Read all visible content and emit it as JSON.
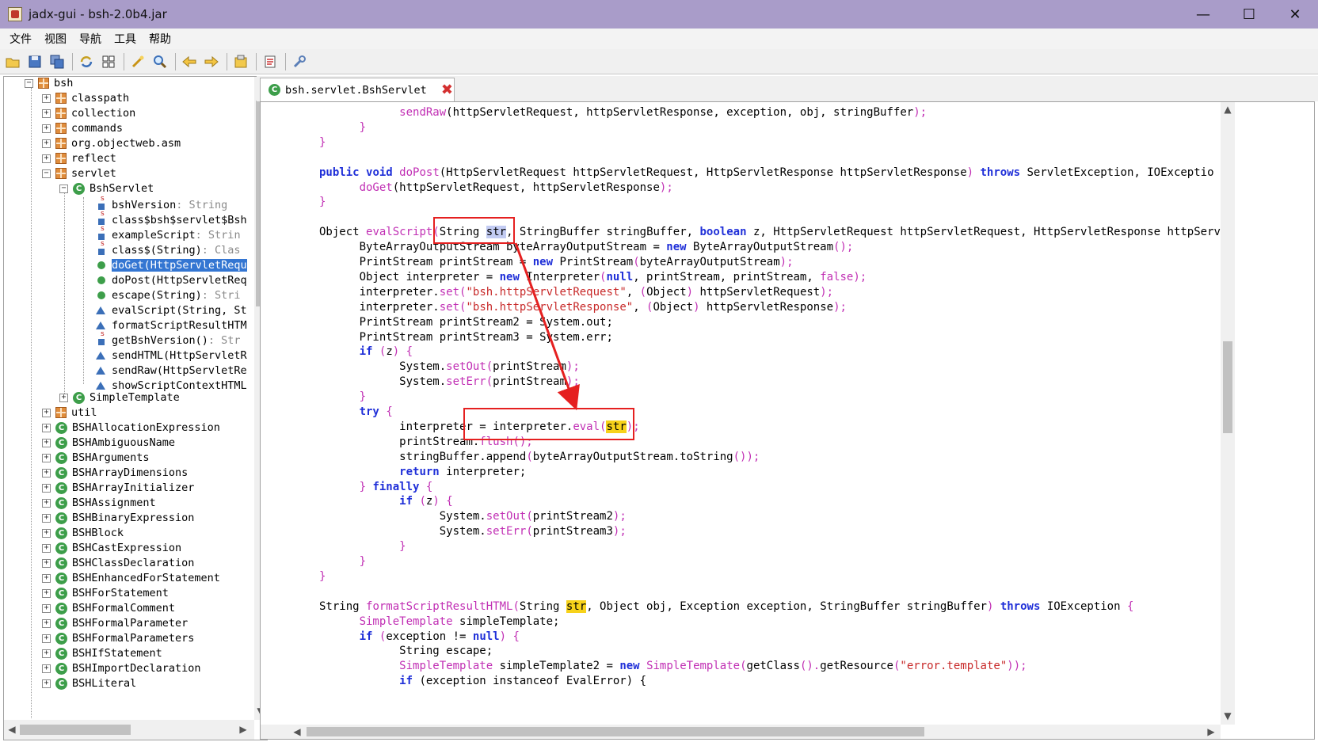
{
  "window": {
    "title": "jadx-gui - bsh-2.0b4.jar",
    "minimize": "—",
    "maximize": "☐",
    "close": "✕"
  },
  "menu": [
    "文件",
    "视图",
    "导航",
    "工具",
    "帮助"
  ],
  "toolbar_icons": [
    "open-file-icon",
    "save-icon",
    "save-all-icon",
    "sync-icon",
    "flatten-icon",
    "decompile-icon",
    "search-icon",
    "back-icon",
    "forward-icon",
    "find-class-icon",
    "log-icon",
    "preferences-icon"
  ],
  "tree": {
    "root": "bsh",
    "packages_top": [
      "classpath",
      "collection",
      "commands",
      "org.objectweb.asm",
      "reflect",
      "servlet"
    ],
    "open_class": "BshServlet",
    "members": [
      {
        "kind": "field",
        "label": "bshVersion",
        "type": " : String"
      },
      {
        "kind": "field",
        "label": "class$bsh$servlet$Bsh",
        "type": ""
      },
      {
        "kind": "field",
        "label": "exampleScript",
        "type": " : Strin"
      },
      {
        "kind": "field",
        "label": "class$(String)",
        "type": " : Clas"
      },
      {
        "kind": "method",
        "label": "doGet(HttpServletRequ",
        "type": ""
      },
      {
        "kind": "method",
        "label": "doPost(HttpServletReq",
        "type": ""
      },
      {
        "kind": "smethod",
        "label": "escape(String)",
        "type": " : Stri"
      },
      {
        "kind": "tri",
        "label": "evalScript(String, St",
        "type": ""
      },
      {
        "kind": "tri",
        "label": "formatScriptResultHTM",
        "type": ""
      },
      {
        "kind": "sfield",
        "label": "getBshVersion()",
        "type": " : Str"
      },
      {
        "kind": "tri",
        "label": "sendHTML(HttpServletR",
        "type": ""
      },
      {
        "kind": "tri",
        "label": "sendRaw(HttpServletRe",
        "type": ""
      },
      {
        "kind": "tri",
        "label": "showScriptContextHTML",
        "type": ""
      }
    ],
    "sibling_class": "SimpleTemplate",
    "util_pkg": "util",
    "classes": [
      "BSHAllocationExpression",
      "BSHAmbiguousName",
      "BSHArguments",
      "BSHArrayDimensions",
      "BSHArrayInitializer",
      "BSHAssignment",
      "BSHBinaryExpression",
      "BSHBlock",
      "BSHCastExpression",
      "BSHClassDeclaration",
      "BSHEnhancedForStatement",
      "BSHForStatement",
      "BSHFormalComment",
      "BSHFormalParameter",
      "BSHFormalParameters",
      "BSHIfStatement",
      "BSHImportDeclaration",
      "BSHLiteral"
    ]
  },
  "tab": {
    "label": "bsh.servlet.BshServlet",
    "close": "✖"
  },
  "code": [
    [
      [
        "    ",
        ""
      ],
      [
        "sendRaw",
        "fn"
      ],
      [
        "(httpServletRequest, httpServletResponse, exception, obj, stringBuffer",
        ""
      ],
      [
        ");",
        "fn"
      ]
    ],
    [
      [
        "  ",
        ""
      ],
      [
        "}",
        "fn"
      ]
    ],
    [
      [
        "}",
        "fn"
      ]
    ],
    [
      [
        "",
        ""
      ]
    ],
    [
      [
        "public",
        "kw"
      ],
      [
        " ",
        ""
      ],
      [
        "void",
        "kw"
      ],
      [
        " ",
        ""
      ],
      [
        "doPost",
        "fn"
      ],
      [
        "(HttpServletRequest httpServletRequest, HttpServletResponse httpServletResponse",
        ""
      ],
      [
        ")",
        "fn"
      ],
      [
        " ",
        ""
      ],
      [
        "throws",
        "kw"
      ],
      [
        " ServletException, IOExceptio",
        ""
      ]
    ],
    [
      [
        "  ",
        ""
      ],
      [
        "doGet",
        "fn"
      ],
      [
        "(httpServletRequest, httpServletResponse",
        ""
      ],
      [
        ");",
        "fn"
      ]
    ],
    [
      [
        "}",
        "fn"
      ]
    ],
    [
      [
        "",
        ""
      ]
    ],
    [
      [
        "Object ",
        ""
      ],
      [
        "evalScript",
        "fn"
      ],
      [
        "(",
        "fn"
      ],
      [
        "String ",
        ""
      ],
      [
        "str",
        "sel"
      ],
      [
        ", StringBuffer stringBuffer, ",
        ""
      ],
      [
        "boolean",
        "kw"
      ],
      [
        " z, HttpServletRequest httpServletRequest, HttpServletResponse httpServ",
        ""
      ]
    ],
    [
      [
        "  ByteArrayOutputStream byteArrayOutputStream = ",
        ""
      ],
      [
        "new",
        "kw"
      ],
      [
        " ByteArrayOutputStream",
        ""
      ],
      [
        "();",
        "fn"
      ]
    ],
    [
      [
        "  PrintStream printStream = ",
        ""
      ],
      [
        "new",
        "kw"
      ],
      [
        " PrintStream",
        ""
      ],
      [
        "(",
        "fn"
      ],
      [
        "byteArrayOutputStream",
        ""
      ],
      [
        ");",
        "fn"
      ]
    ],
    [
      [
        "  Object interpreter = ",
        ""
      ],
      [
        "new",
        "kw"
      ],
      [
        " Interpreter",
        ""
      ],
      [
        "(",
        "fn"
      ],
      [
        "null",
        "kw"
      ],
      [
        ", printStream, printStream, ",
        ""
      ],
      [
        "false",
        "fn"
      ],
      [
        ");",
        "fn"
      ]
    ],
    [
      [
        "  interpreter.",
        ""
      ],
      [
        "set",
        "fn"
      ],
      [
        "(",
        "fn"
      ],
      [
        "\"bsh.httpServletRequest\"",
        "str"
      ],
      [
        ", ",
        ""
      ],
      [
        "(",
        "fn"
      ],
      [
        "Object",
        ""
      ],
      [
        ")",
        "fn"
      ],
      [
        " httpServletRequest",
        ""
      ],
      [
        ");",
        "fn"
      ]
    ],
    [
      [
        "  interpreter.",
        ""
      ],
      [
        "set",
        "fn"
      ],
      [
        "(",
        "fn"
      ],
      [
        "\"bsh.httpServletResponse\"",
        "str"
      ],
      [
        ", ",
        ""
      ],
      [
        "(",
        "fn"
      ],
      [
        "Object",
        ""
      ],
      [
        ")",
        "fn"
      ],
      [
        " httpServletResponse",
        ""
      ],
      [
        ");",
        "fn"
      ]
    ],
    [
      [
        "  PrintStream printStream2 = System.out;",
        ""
      ]
    ],
    [
      [
        "  PrintStream printStream3 = System.err;",
        ""
      ]
    ],
    [
      [
        "  ",
        ""
      ],
      [
        "if",
        "kw"
      ],
      [
        " ",
        ""
      ],
      [
        "(",
        "fn"
      ],
      [
        "z",
        ""
      ],
      [
        ")",
        "fn"
      ],
      [
        " ",
        ""
      ],
      [
        "{",
        "fn"
      ]
    ],
    [
      [
        "    System.",
        ""
      ],
      [
        "setOut",
        "fn"
      ],
      [
        "(",
        "fn"
      ],
      [
        "printStream",
        ""
      ],
      [
        ");",
        "fn"
      ]
    ],
    [
      [
        "    System.",
        ""
      ],
      [
        "setErr",
        "fn"
      ],
      [
        "(",
        "fn"
      ],
      [
        "printStream",
        ""
      ],
      [
        ");",
        "fn"
      ]
    ],
    [
      [
        "  ",
        ""
      ],
      [
        "}",
        "fn"
      ]
    ],
    [
      [
        "  ",
        ""
      ],
      [
        "try",
        "kw"
      ],
      [
        " ",
        ""
      ],
      [
        "{",
        "fn"
      ]
    ],
    [
      [
        "    interpreter = interpreter.",
        ""
      ],
      [
        "eval",
        "fn"
      ],
      [
        "(",
        "fn"
      ],
      [
        "str",
        "yel"
      ],
      [
        ");",
        "fn"
      ]
    ],
    [
      [
        "    printStream.",
        ""
      ],
      [
        "flush",
        "fn"
      ],
      [
        "();",
        "fn"
      ]
    ],
    [
      [
        "    stringBuffer.append",
        ""
      ],
      [
        "(",
        "fn"
      ],
      [
        "byteArrayOutputStream.toString",
        ""
      ],
      [
        "());",
        "fn"
      ]
    ],
    [
      [
        "    ",
        ""
      ],
      [
        "return",
        "kw"
      ],
      [
        " interpreter;",
        ""
      ]
    ],
    [
      [
        "  ",
        ""
      ],
      [
        "}",
        "fn"
      ],
      [
        " ",
        ""
      ],
      [
        "finally",
        "kw"
      ],
      [
        " ",
        ""
      ],
      [
        "{",
        "fn"
      ]
    ],
    [
      [
        "    ",
        ""
      ],
      [
        "if",
        "kw"
      ],
      [
        " ",
        ""
      ],
      [
        "(",
        "fn"
      ],
      [
        "z",
        ""
      ],
      [
        ")",
        "fn"
      ],
      [
        " ",
        ""
      ],
      [
        "{",
        "fn"
      ]
    ],
    [
      [
        "      System.",
        ""
      ],
      [
        "setOut",
        "fn"
      ],
      [
        "(",
        "fn"
      ],
      [
        "printStream2",
        ""
      ],
      [
        ");",
        "fn"
      ]
    ],
    [
      [
        "      System.",
        ""
      ],
      [
        "setErr",
        "fn"
      ],
      [
        "(",
        "fn"
      ],
      [
        "printStream3",
        ""
      ],
      [
        ");",
        "fn"
      ]
    ],
    [
      [
        "    ",
        ""
      ],
      [
        "}",
        "fn"
      ]
    ],
    [
      [
        "  ",
        ""
      ],
      [
        "}",
        "fn"
      ]
    ],
    [
      [
        "}",
        "fn"
      ]
    ],
    [
      [
        "",
        ""
      ]
    ],
    [
      [
        "String ",
        ""
      ],
      [
        "formatScriptResultHTML",
        "fn"
      ],
      [
        "(",
        "fn"
      ],
      [
        "String ",
        ""
      ],
      [
        "str",
        "yel"
      ],
      [
        ", Object obj, Exception exception, StringBuffer stringBuffer",
        ""
      ],
      [
        ")",
        "fn"
      ],
      [
        " ",
        ""
      ],
      [
        "throws",
        "kw"
      ],
      [
        " IOException ",
        ""
      ],
      [
        "{",
        "fn"
      ]
    ],
    [
      [
        "  ",
        ""
      ],
      [
        "SimpleTemplate",
        "fn"
      ],
      [
        " simpleTemplate;",
        ""
      ]
    ],
    [
      [
        "  ",
        ""
      ],
      [
        "if",
        "kw"
      ],
      [
        " ",
        ""
      ],
      [
        "(",
        "fn"
      ],
      [
        "exception != ",
        ""
      ],
      [
        "null",
        "kw"
      ],
      [
        ")",
        "fn"
      ],
      [
        " ",
        ""
      ],
      [
        "{",
        "fn"
      ]
    ],
    [
      [
        "    String escape;",
        ""
      ]
    ],
    [
      [
        "    ",
        ""
      ],
      [
        "SimpleTemplate",
        "fn"
      ],
      [
        " simpleTemplate2 = ",
        ""
      ],
      [
        "new",
        "kw"
      ],
      [
        " ",
        ""
      ],
      [
        "SimpleTemplate",
        "fn"
      ],
      [
        "(",
        "fn"
      ],
      [
        "getClass",
        ""
      ],
      [
        "().",
        "fn"
      ],
      [
        "getResource",
        ""
      ],
      [
        "(",
        "fn"
      ],
      [
        "\"error.template\"",
        "str"
      ],
      [
        "));",
        "fn"
      ]
    ],
    [
      [
        "    ",
        ""
      ],
      [
        "if",
        "kw"
      ],
      [
        " (exception instanceof EvalError) {",
        ""
      ]
    ]
  ],
  "colors": {
    "titlebar": "#a99cc9",
    "keyword": "#1f2fd8",
    "method": "#c12fb4",
    "string": "#c82a2a",
    "selection": "#3476d2",
    "annotation": "#e52020"
  }
}
